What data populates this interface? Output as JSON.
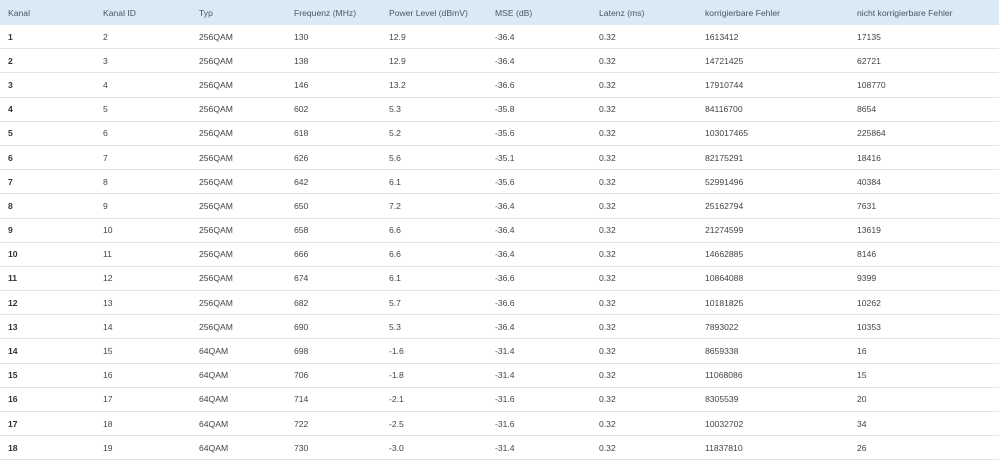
{
  "table": {
    "headers": [
      "Kanal",
      "Kanal ID",
      "Typ",
      "Frequenz (MHz)",
      "Power Level (dBmV)",
      "MSE (dB)",
      "Latenz (ms)",
      "korrigierbare Fehler",
      "nicht korrigierbare Fehler"
    ],
    "rows": [
      [
        "1",
        "2",
        "256QAM",
        "130",
        "12.9",
        "-36.4",
        "0.32",
        "1613412",
        "17135"
      ],
      [
        "2",
        "3",
        "256QAM",
        "138",
        "12.9",
        "-36.4",
        "0.32",
        "14721425",
        "62721"
      ],
      [
        "3",
        "4",
        "256QAM",
        "146",
        "13.2",
        "-36.6",
        "0.32",
        "17910744",
        "108770"
      ],
      [
        "4",
        "5",
        "256QAM",
        "602",
        "5.3",
        "-35.8",
        "0.32",
        "84116700",
        "8654"
      ],
      [
        "5",
        "6",
        "256QAM",
        "618",
        "5.2",
        "-35.6",
        "0.32",
        "103017465",
        "225864"
      ],
      [
        "6",
        "7",
        "256QAM",
        "626",
        "5.6",
        "-35.1",
        "0.32",
        "82175291",
        "18416"
      ],
      [
        "7",
        "8",
        "256QAM",
        "642",
        "6.1",
        "-35.6",
        "0.32",
        "52991496",
        "40384"
      ],
      [
        "8",
        "9",
        "256QAM",
        "650",
        "7.2",
        "-36.4",
        "0.32",
        "25162794",
        "7631"
      ],
      [
        "9",
        "10",
        "256QAM",
        "658",
        "6.6",
        "-36.4",
        "0.32",
        "21274599",
        "13619"
      ],
      [
        "10",
        "11",
        "256QAM",
        "666",
        "6.6",
        "-36.4",
        "0.32",
        "14662885",
        "8146"
      ],
      [
        "11",
        "12",
        "256QAM",
        "674",
        "6.1",
        "-36.6",
        "0.32",
        "10864088",
        "9399"
      ],
      [
        "12",
        "13",
        "256QAM",
        "682",
        "5.7",
        "-36.6",
        "0.32",
        "10181825",
        "10262"
      ],
      [
        "13",
        "14",
        "256QAM",
        "690",
        "5.3",
        "-36.4",
        "0.32",
        "7893022",
        "10353"
      ],
      [
        "14",
        "15",
        "64QAM",
        "698",
        "-1.6",
        "-31.4",
        "0.32",
        "8659338",
        "16"
      ],
      [
        "15",
        "16",
        "64QAM",
        "706",
        "-1.8",
        "-31.4",
        "0.32",
        "11068086",
        "15"
      ],
      [
        "16",
        "17",
        "64QAM",
        "714",
        "-2.1",
        "-31.6",
        "0.32",
        "8305539",
        "20"
      ],
      [
        "17",
        "18",
        "64QAM",
        "722",
        "-2.5",
        "-31.6",
        "0.32",
        "10032702",
        "34"
      ],
      [
        "18",
        "19",
        "64QAM",
        "730",
        "-3.0",
        "-31.4",
        "0.32",
        "11837810",
        "26"
      ]
    ]
  },
  "colors": {
    "header_background": "#dbe9f5",
    "row_divider": "#e4e4e4",
    "text": "#444444"
  }
}
